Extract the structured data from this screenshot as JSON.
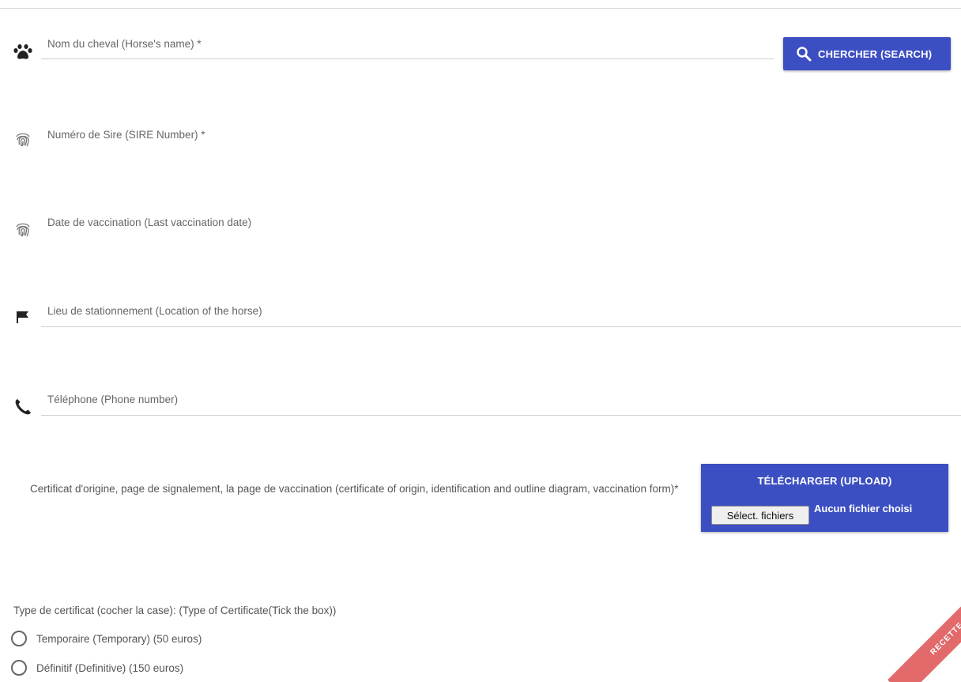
{
  "form": {
    "horse_name": {
      "label": "Nom du cheval (Horse's name) *",
      "value": ""
    },
    "search_button": {
      "label": "CHERCHER (SEARCH)"
    },
    "sire_number": {
      "label": "Numéro de Sire (SIRE Number) *",
      "value": ""
    },
    "vaccination_date": {
      "label": "Date de vaccination (Last vaccination date)",
      "value": ""
    },
    "location": {
      "label": "Lieu de stationnement (Location of the horse)",
      "value": ""
    },
    "phone": {
      "label": "Téléphone (Phone number)",
      "value": ""
    }
  },
  "certificate": {
    "description": "Certificat d'origine, page de signalement, la page de vaccination (certificate of origin, identification and outline diagram, vaccination form)*",
    "upload_title": "TÉLÉCHARGER (UPLOAD)",
    "file_button": "Sélect. fichiers",
    "file_status": "Aucun fichier choisi"
  },
  "certificate_type": {
    "label": "Type de certificat (cocher la case): (Type of Certificate(Tick the box))",
    "options": [
      {
        "label": "Temporaire (Temporary) (50 euros)",
        "selected": false
      },
      {
        "label": "Définitif (Definitive) (150 euros)",
        "selected": false
      }
    ]
  },
  "environment_ribbon": "RECETTE",
  "colors": {
    "primary": "#3c4fc2",
    "ribbon": "#e26a6a"
  },
  "icons": [
    "paw-icon",
    "search-icon",
    "fingerprint-icon",
    "flag-icon",
    "phone-icon"
  ]
}
